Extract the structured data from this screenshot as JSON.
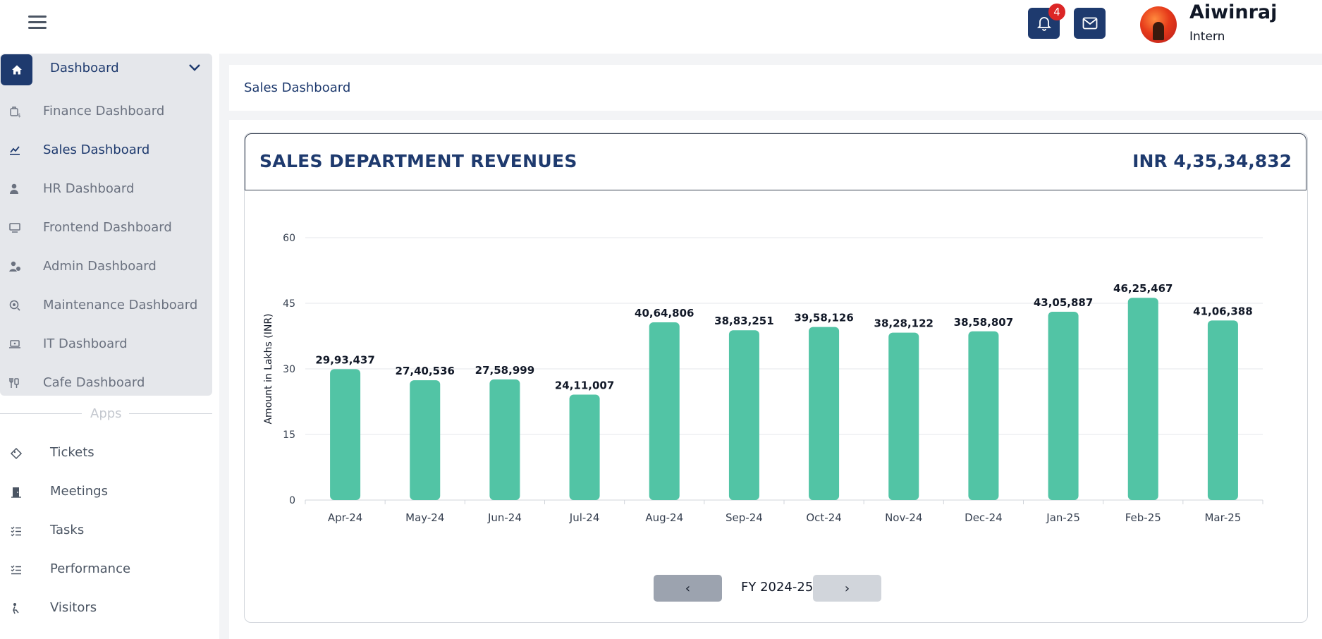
{
  "header": {
    "notification_count": "4",
    "user_name": "Aiwinraj",
    "user_role": "Intern",
    "accent": "#1e3a6e"
  },
  "sidebar": {
    "group_title": "Dashboard",
    "items": [
      {
        "label": "Finance Dashboard",
        "icon": "finance-icon"
      },
      {
        "label": "Sales Dashboard",
        "icon": "chart-line-icon",
        "active": true
      },
      {
        "label": "HR Dashboard",
        "icon": "user-icon"
      },
      {
        "label": "Frontend Dashboard",
        "icon": "monitor-icon"
      },
      {
        "label": "Admin Dashboard",
        "icon": "admin-icon"
      },
      {
        "label": "Maintenance Dashboard",
        "icon": "gear-icon"
      },
      {
        "label": "IT Dashboard",
        "icon": "laptop-icon"
      },
      {
        "label": "Cafe Dashboard",
        "icon": "cafe-icon"
      }
    ],
    "apps_label": "Apps",
    "apps": [
      {
        "label": "Tickets",
        "icon": "ticket-icon"
      },
      {
        "label": "Meetings",
        "icon": "door-icon"
      },
      {
        "label": "Tasks",
        "icon": "tasks-icon"
      },
      {
        "label": "Performance",
        "icon": "performance-icon"
      },
      {
        "label": "Visitors",
        "icon": "visitor-icon"
      }
    ]
  },
  "breadcrumb": {
    "title": "Sales Dashboard"
  },
  "card": {
    "title": "SALES DEPARTMENT REVENUES",
    "total": "INR 4,35,34,832"
  },
  "pager": {
    "prev": "‹",
    "next": "›",
    "label": "FY 2024-25"
  },
  "chart_data": {
    "type": "bar",
    "ylabel": "Amount in Lakhs (INR)",
    "ylim": [
      0,
      60
    ],
    "yticks": [
      0,
      15,
      30,
      45,
      60
    ],
    "grid": true,
    "bar_color": "#52c4a5",
    "categories": [
      "Apr-24",
      "May-24",
      "Jun-24",
      "Jul-24",
      "Aug-24",
      "Sep-24",
      "Oct-24",
      "Nov-24",
      "Dec-24",
      "Jan-25",
      "Feb-25",
      "Mar-25"
    ],
    "values": [
      29.93437,
      27.40536,
      27.58999,
      24.11007,
      40.64806,
      38.83251,
      39.58126,
      38.28122,
      38.58807,
      43.05887,
      46.25467,
      41.06388
    ],
    "data_labels": [
      "29,93,437",
      "27,40,536",
      "27,58,999",
      "24,11,007",
      "40,64,806",
      "38,83,251",
      "39,58,126",
      "38,28,122",
      "38,58,807",
      "43,05,887",
      "46,25,467",
      "41,06,388"
    ]
  }
}
